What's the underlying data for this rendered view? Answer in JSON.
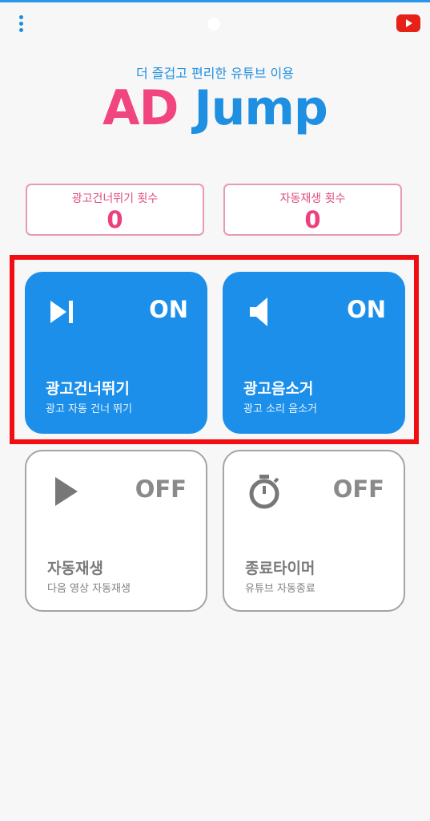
{
  "app": {
    "tagline": "더 즐겁고 편리한 유튜브 이용",
    "logo_ad": "AD",
    "logo_jump": "Jump"
  },
  "counters": [
    {
      "label": "광고건너뛰기 횟수",
      "value": "0"
    },
    {
      "label": "자동재생 횟수",
      "value": "0"
    }
  ],
  "features": [
    {
      "title": "광고건너뛰기",
      "subtitle": "광고 자동 건너 뛰기",
      "state": "ON",
      "icon": "skip-next-icon"
    },
    {
      "title": "광고음소거",
      "subtitle": "광고 소리 음소거",
      "state": "ON",
      "icon": "speaker-icon"
    },
    {
      "title": "자동재생",
      "subtitle": "다음 영상 자동재생",
      "state": "OFF",
      "icon": "play-icon"
    },
    {
      "title": "종료타이머",
      "subtitle": "유튜브 자동종료",
      "state": "OFF",
      "icon": "stopwatch-icon"
    }
  ],
  "colors": {
    "accent_blue": "#1b8fea",
    "logo_pink": "#f0457f",
    "highlight_red": "#f20d12",
    "youtube_red": "#e62117"
  }
}
